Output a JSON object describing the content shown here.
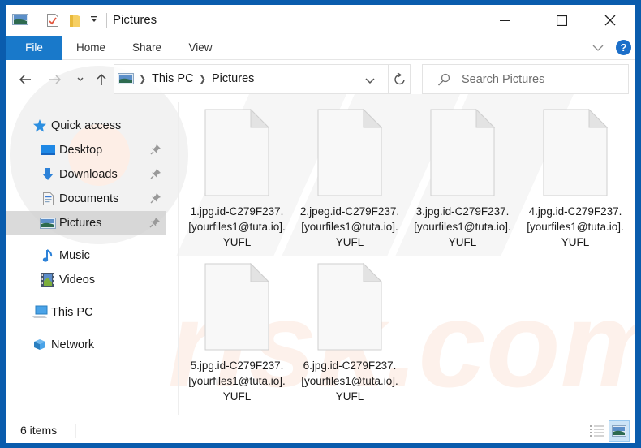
{
  "window": {
    "title": "Pictures",
    "controls": {
      "minimize": "minimize",
      "maximize": "maximize",
      "close": "close"
    }
  },
  "quick_access_toolbar": {
    "icons": [
      "pictures-folder-icon",
      "properties-icon",
      "new-folder-icon",
      "customize-dropdown-icon"
    ]
  },
  "ribbon": {
    "tabs": [
      {
        "label": "File",
        "active": true
      },
      {
        "label": "Home"
      },
      {
        "label": "Share"
      },
      {
        "label": "View"
      }
    ],
    "help_label": "?"
  },
  "navigation": {
    "breadcrumb": [
      "This PC",
      "Pictures"
    ],
    "search_placeholder": "Search Pictures"
  },
  "sidebar": {
    "items": [
      {
        "label": "Quick access",
        "icon": "star-icon",
        "level": 0
      },
      {
        "label": "Desktop",
        "icon": "desktop-icon",
        "level": 1,
        "pinned": true
      },
      {
        "label": "Downloads",
        "icon": "download-arrow-icon",
        "level": 1,
        "pinned": true
      },
      {
        "label": "Documents",
        "icon": "documents-icon",
        "level": 1,
        "pinned": true
      },
      {
        "label": "Pictures",
        "icon": "pictures-icon",
        "level": 1,
        "pinned": true,
        "selected": true
      },
      {
        "label": "Music",
        "icon": "music-note-icon",
        "level": 1
      },
      {
        "label": "Videos",
        "icon": "videos-icon",
        "level": 1
      },
      {
        "label": "This PC",
        "icon": "computer-icon",
        "level": 0
      },
      {
        "label": "Network",
        "icon": "network-icon",
        "level": 0
      }
    ]
  },
  "files": [
    {
      "name": "1.jpg.id-C279F237.[yourfiles1@tuta.io].YUFL"
    },
    {
      "name": "2.jpeg.id-C279F237.[yourfiles1@tuta.io].YUFL"
    },
    {
      "name": "3.jpg.id-C279F237.[yourfiles1@tuta.io].YUFL"
    },
    {
      "name": "4.jpg.id-C279F237.[yourfiles1@tuta.io].YUFL"
    },
    {
      "name": "5.jpg.id-C279F237.[yourfiles1@tuta.io].YUFL"
    },
    {
      "name": "6.jpg.id-C279F237.[yourfiles1@tuta.io].YUFL"
    }
  ],
  "status": {
    "item_count": "6 items",
    "view_modes": [
      "details-view",
      "large-icons-view"
    ],
    "active_view": "large-icons-view"
  },
  "colors": {
    "frame": "#0a5cad",
    "file_tab": "#1979ca",
    "selected_item": "#d9d9d9",
    "help_button": "#1c6fc9"
  }
}
